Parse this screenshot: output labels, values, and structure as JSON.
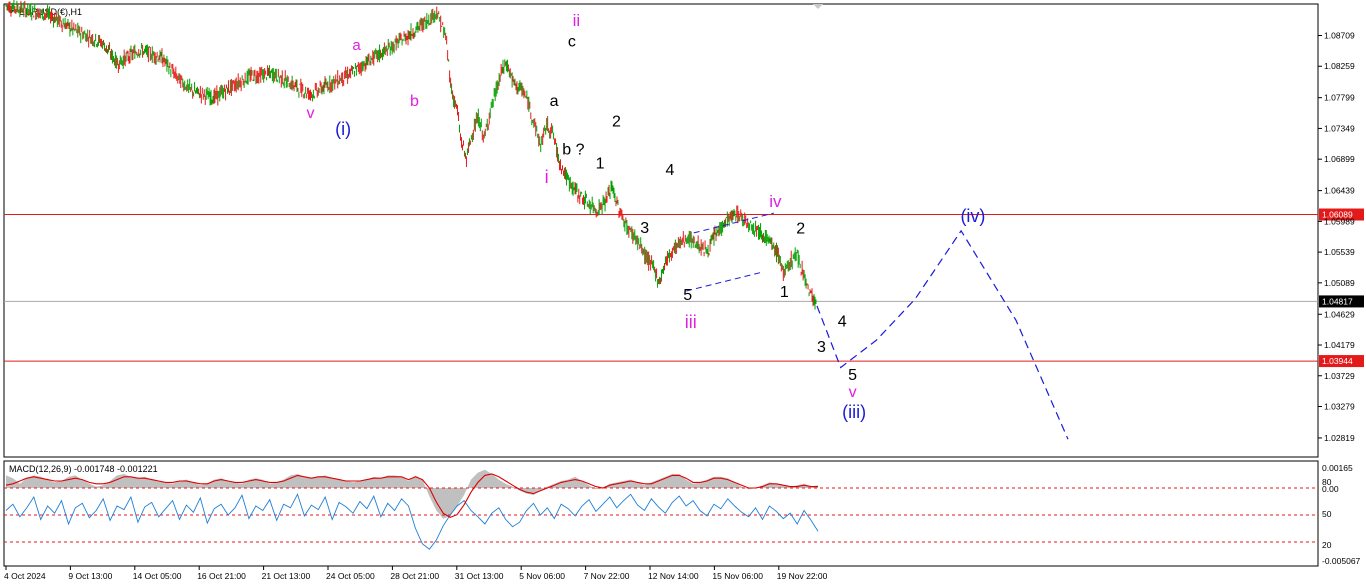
{
  "chart_data": [
    {
      "type": "line",
      "title": "EURUSD(€),H1",
      "xlabel": "",
      "ylabel": "",
      "ylim": [
        1.0254,
        1.0917
      ],
      "y_ticks": [
        "1.08709",
        "1.08259",
        "1.07799",
        "1.07349",
        "1.06899",
        "1.06439",
        "1.05989",
        "1.05539",
        "1.05089",
        "1.04629",
        "1.04179",
        "1.03729",
        "1.03279",
        "1.02819"
      ],
      "x_tick_labels": [
        "4 Oct 2024",
        "9 Oct 13:00",
        "14 Oct 05:00",
        "16 Oct 21:00",
        "21 Oct 13:00",
        "24 Oct 05:00",
        "28 Oct 21:00",
        "31 Oct 13:00",
        "5 Nov 06:00",
        "7 Nov 22:00",
        "12 Nov 14:00",
        "15 Nov 06:00",
        "19 Nov 22:00"
      ],
      "price_path": [
        [
          0,
          1.0915
        ],
        [
          30,
          1.09
        ],
        [
          45,
          1.088
        ],
        [
          65,
          1.086
        ],
        [
          75,
          1.083
        ],
        [
          90,
          1.085
        ],
        [
          105,
          1.0838
        ],
        [
          115,
          1.081
        ],
        [
          125,
          1.079
        ],
        [
          140,
          1.078
        ],
        [
          155,
          1.08
        ],
        [
          165,
          1.0812
        ],
        [
          180,
          1.0815
        ],
        [
          192,
          1.08
        ],
        [
          205,
          1.0785
        ],
        [
          218,
          1.08
        ],
        [
          232,
          1.0815
        ],
        [
          245,
          1.0835
        ],
        [
          258,
          1.0852
        ],
        [
          270,
          1.087
        ],
        [
          282,
          1.089
        ],
        [
          290,
          1.0905
        ],
        [
          296,
          1.087
        ],
        [
          300,
          1.079
        ],
        [
          304,
          1.076
        ],
        [
          306,
          1.072
        ],
        [
          310,
          1.069
        ],
        [
          314,
          1.073
        ],
        [
          318,
          1.075
        ],
        [
          322,
          1.072
        ],
        [
          326,
          1.076
        ],
        [
          330,
          1.079
        ],
        [
          334,
          1.082
        ],
        [
          337,
          1.083
        ],
        [
          342,
          1.08
        ],
        [
          348,
          1.079
        ],
        [
          352,
          1.077
        ],
        [
          356,
          1.074
        ],
        [
          360,
          1.071
        ],
        [
          364,
          1.074
        ],
        [
          368,
          1.073
        ],
        [
          372,
          1.069
        ],
        [
          378,
          1.066
        ],
        [
          385,
          1.064
        ],
        [
          392,
          1.0625
        ],
        [
          398,
          1.0615
        ],
        [
          404,
          1.063
        ],
        [
          408,
          1.065
        ],
        [
          412,
          1.062
        ],
        [
          418,
          1.059
        ],
        [
          424,
          1.0575
        ],
        [
          430,
          1.055
        ],
        [
          436,
          1.053
        ],
        [
          440,
          1.051
        ],
        [
          444,
          1.054
        ],
        [
          450,
          1.056
        ],
        [
          458,
          1.0575
        ],
        [
          466,
          1.0565
        ],
        [
          472,
          1.0555
        ],
        [
          478,
          1.058
        ],
        [
          485,
          1.06
        ],
        [
          492,
          1.061
        ],
        [
          498,
          1.06
        ],
        [
          504,
          1.059
        ],
        [
          510,
          1.058
        ],
        [
          515,
          1.0565
        ],
        [
          520,
          1.055
        ],
        [
          524,
          1.052
        ],
        [
          528,
          1.054
        ],
        [
          532,
          1.055
        ],
        [
          536,
          1.053
        ],
        [
          540,
          1.05
        ],
        [
          544,
          1.0485
        ],
        [
          546,
          1.047
        ]
      ],
      "projection_path": [
        [
          546,
          1.0475
        ],
        [
          562,
          1.0385
        ],
        [
          586,
          1.0425
        ],
        [
          612,
          1.0485
        ],
        [
          643,
          1.0585
        ],
        [
          680,
          1.0454
        ],
        [
          715,
          1.028
        ]
      ],
      "horizontal_lines": [
        {
          "value": 1.06089,
          "label": "1.06089",
          "color": "#e41a1a"
        },
        {
          "value": 1.04817,
          "label": "1.04817",
          "color": "#a8a8a8"
        },
        {
          "value": 1.03944,
          "label": "1.03944",
          "color": "#e41a1a"
        }
      ],
      "channel": {
        "upper": [
          [
            463,
            1.0582
          ],
          [
            517,
            1.0611
          ]
        ],
        "lower": [
          [
            458,
            1.0497
          ],
          [
            510,
            1.0525
          ]
        ]
      },
      "wave_labels": [
        {
          "text": "v",
          "x": 205,
          "y": 1.075,
          "color": "#e020e0",
          "size": 16
        },
        {
          "text": "(i)",
          "x": 227,
          "y": 1.0725,
          "color": "#1a1ad8",
          "size": 18
        },
        {
          "text": "a",
          "x": 236,
          "y": 1.085,
          "color": "#e020e0",
          "size": 15
        },
        {
          "text": "b",
          "x": 275,
          "y": 1.0768,
          "color": "#e020e0",
          "size": 16
        },
        {
          "text": "ii",
          "x": 384,
          "y": 1.0885,
          "color": "#e020e0",
          "size": 17
        },
        {
          "text": "c",
          "x": 381,
          "y": 1.0855,
          "color": "#000000",
          "size": 16
        },
        {
          "text": "a",
          "x": 369,
          "y": 1.0768,
          "color": "#000000",
          "size": 16
        },
        {
          "text": "b ?",
          "x": 382,
          "y": 1.0697,
          "color": "#000000",
          "size": 16
        },
        {
          "text": "i",
          "x": 364,
          "y": 1.0655,
          "color": "#e020e0",
          "size": 18
        },
        {
          "text": "2",
          "x": 411,
          "y": 1.0738,
          "color": "#000000",
          "size": 16
        },
        {
          "text": "1",
          "x": 400,
          "y": 1.0676,
          "color": "#000000",
          "size": 16
        },
        {
          "text": "4",
          "x": 447,
          "y": 1.0667,
          "color": "#000000",
          "size": 16
        },
        {
          "text": "3",
          "x": 430,
          "y": 1.0582,
          "color": "#000000",
          "size": 16
        },
        {
          "text": "iv",
          "x": 518,
          "y": 1.062,
          "color": "#e020e0",
          "size": 17
        },
        {
          "text": "2",
          "x": 535,
          "y": 1.0581,
          "color": "#000000",
          "size": 16
        },
        {
          "text": "5",
          "x": 459,
          "y": 1.0484,
          "color": "#000000",
          "size": 16
        },
        {
          "text": "iii",
          "x": 461,
          "y": 1.0443,
          "color": "#e020e0",
          "size": 18
        },
        {
          "text": "1",
          "x": 524,
          "y": 1.0488,
          "color": "#000000",
          "size": 16
        },
        {
          "text": "4",
          "x": 563,
          "y": 1.0445,
          "color": "#000000",
          "size": 16
        },
        {
          "text": "3",
          "x": 549,
          "y": 1.0408,
          "color": "#000000",
          "size": 16
        },
        {
          "text": "5",
          "x": 570,
          "y": 1.0367,
          "color": "#000000",
          "size": 16
        },
        {
          "text": "v",
          "x": 570,
          "y": 1.0342,
          "color": "#e020e0",
          "size": 16
        },
        {
          "text": "(iii)",
          "x": 571,
          "y": 1.0311,
          "color": "#1a1ad8",
          "size": 18
        },
        {
          "text": "(iv)",
          "x": 651,
          "y": 1.0598,
          "color": "#1a1ad8",
          "size": 18
        }
      ],
      "grid": false,
      "series": [
        {
          "name": "EURUSD",
          "color": "#00a000",
          "down_color": "#e41a1a"
        }
      ]
    },
    {
      "type": "line",
      "title": "MACD(12,26,9) -0.001748 -0.001221",
      "ylim": [
        -0.00507,
        0.00165
      ],
      "right_labels": [
        "0.00165",
        "80",
        "0.00",
        "50",
        "20",
        "-0.005067"
      ],
      "level_lines": [
        80,
        50,
        20
      ],
      "histogram_color": "#c0c0c0",
      "signal_color": "#e00000",
      "oscillator_color": "#1e7fd8",
      "series": [
        {
          "name": "histogram",
          "values": [
            0.9,
            0.7,
            0.3,
            0.7,
            0.9,
            0.8,
            0.6,
            0.4,
            0.5,
            0.8,
            0.9,
            0.6,
            0.3,
            0.1,
            0.2,
            0.5,
            0.9,
            1.0,
            0.8,
            0.7,
            0.8,
            0.6,
            0.5,
            0.4,
            0.3,
            0.5,
            0.6,
            0.4,
            0.2,
            0.3,
            0.6,
            0.7,
            0.5,
            0.4,
            0.3,
            0.6,
            0.7,
            0.6,
            0.3,
            0.4,
            0.6,
            0.9,
            1.0,
            0.8,
            0.7,
            0.8,
            0.9,
            0.7,
            0.6,
            0.5,
            0.4,
            0.5,
            0.6,
            0.8,
            0.7,
            0.9,
            0.9,
            0.8,
            0.5,
            0.9,
            0.6,
            -0.6,
            -1.6,
            -2.2,
            -2.0,
            -1.3,
            -0.5,
            0.6,
            1.1,
            1.3,
            1.0,
            0.6,
            0.3,
            0.1,
            -0.2,
            -0.4,
            -0.5,
            -0.2,
            0.1,
            0.3,
            0.5,
            0.6,
            0.8,
            0.5,
            0.2,
            -0.1,
            0.0,
            0.3,
            0.4,
            0.5,
            0.6,
            0.4,
            0.2,
            0.4,
            0.6,
            0.8,
            1.0,
            1.0,
            0.6,
            0.3,
            0.4,
            0.6,
            0.8,
            0.8,
            0.7,
            0.4,
            0.1,
            -0.1,
            0.0,
            0.2,
            0.4,
            0.3,
            0.2,
            0.1,
            0.2,
            0.3,
            0.1,
            0.2
          ]
        },
        {
          "name": "signal",
          "values": [
            0.2,
            0.3,
            0.5,
            0.7,
            0.8,
            0.7,
            0.6,
            0.5,
            0.5,
            0.6,
            0.7,
            0.6,
            0.4,
            0.3,
            0.3,
            0.4,
            0.6,
            0.8,
            0.8,
            0.7,
            0.7,
            0.6,
            0.5,
            0.4,
            0.4,
            0.5,
            0.5,
            0.4,
            0.3,
            0.3,
            0.5,
            0.6,
            0.5,
            0.4,
            0.4,
            0.5,
            0.6,
            0.5,
            0.4,
            0.4,
            0.5,
            0.7,
            0.9,
            0.8,
            0.7,
            0.8,
            0.8,
            0.7,
            0.6,
            0.5,
            0.5,
            0.5,
            0.6,
            0.7,
            0.7,
            0.8,
            0.8,
            0.8,
            0.6,
            0.8,
            0.6,
            0.0,
            -1.0,
            -1.8,
            -2.1,
            -1.9,
            -1.2,
            -0.3,
            0.4,
            0.9,
            1.0,
            0.8,
            0.5,
            0.2,
            -0.1,
            -0.3,
            -0.4,
            -0.2,
            0.0,
            0.2,
            0.4,
            0.5,
            0.6,
            0.5,
            0.3,
            0.1,
            0.0,
            0.2,
            0.3,
            0.4,
            0.5,
            0.4,
            0.3,
            0.3,
            0.5,
            0.7,
            0.9,
            0.9,
            0.7,
            0.4,
            0.4,
            0.5,
            0.7,
            0.7,
            0.6,
            0.4,
            0.2,
            0.0,
            0.0,
            0.1,
            0.3,
            0.3,
            0.2,
            0.1,
            0.1,
            0.2,
            0.1,
            0.1
          ]
        },
        {
          "name": "oscillator",
          "values": [
            55,
            62,
            48,
            58,
            70,
            45,
            60,
            52,
            66,
            40,
            58,
            63,
            47,
            55,
            68,
            44,
            60,
            56,
            70,
            42,
            59,
            64,
            48,
            57,
            66,
            45,
            61,
            53,
            69,
            41,
            57,
            62,
            50,
            58,
            72,
            46,
            60,
            55,
            67,
            44,
            62,
            58,
            73,
            49,
            61,
            56,
            70,
            45,
            64,
            59,
            52,
            65,
            57,
            71,
            48,
            63,
            55,
            68,
            60,
            35,
            18,
            12,
            22,
            38,
            50,
            60,
            66,
            55,
            48,
            40,
            52,
            58,
            45,
            37,
            42,
            55,
            63,
            50,
            58,
            46,
            62,
            57,
            49,
            60,
            67,
            54,
            62,
            70,
            58,
            66,
            73,
            61,
            55,
            68,
            59,
            52,
            64,
            71,
            60,
            66,
            55,
            49,
            62,
            57,
            68,
            60,
            53,
            48,
            58,
            45,
            60,
            54,
            46,
            52,
            40,
            55,
            44,
            32
          ]
        }
      ]
    }
  ]
}
